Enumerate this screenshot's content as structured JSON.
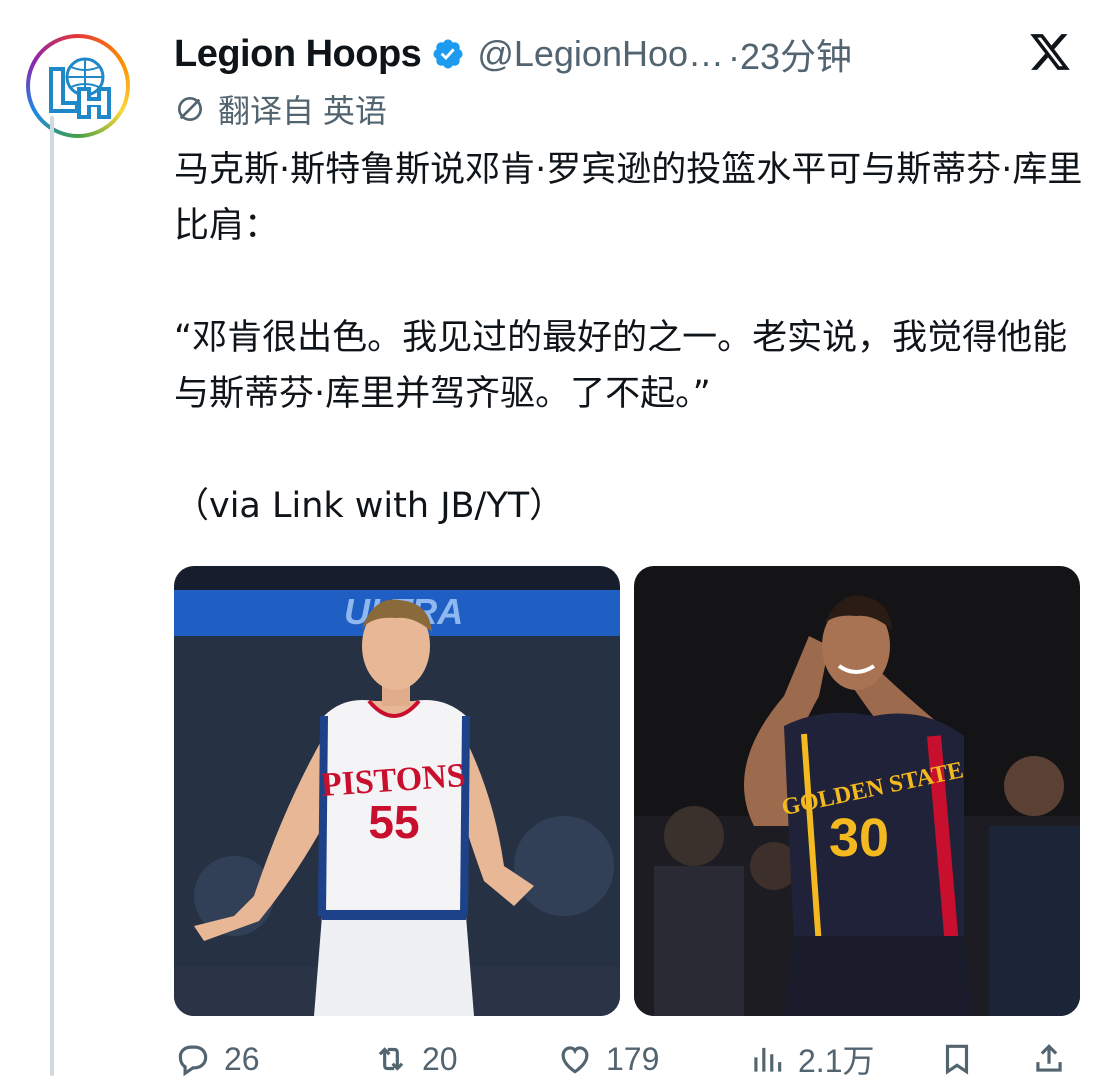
{
  "author": {
    "name": "Legion Hoops",
    "handle": "@LegionHoo…",
    "time": "·23分钟",
    "avatar_text": "LH"
  },
  "translated": "翻译自 英语",
  "tweet": {
    "p1": "马克斯·斯特鲁斯说邓肯·罗宾逊的投篮水平可与斯蒂芬·库里比肩：",
    "p2": "“邓肯很出色。我见过的最好的之一。老实说，我觉得他能与斯蒂芬·库里并驾齐驱。了不起。”",
    "p3": "（via Link with JB/YT）"
  },
  "media": {
    "left": {
      "jersey_team": "PISTONS",
      "jersey_number": "55",
      "arena_sign": "ULTRA"
    },
    "right": {
      "jersey_team": "GOLDEN STATE",
      "jersey_number": "30"
    }
  },
  "actions": {
    "replies": "26",
    "retweets": "20",
    "likes": "179",
    "views": "2.1万"
  },
  "colors": {
    "verified": "#1d9bf0",
    "muted": "#536471",
    "text": "#0f1419",
    "thread_line": "#cfd9de"
  }
}
